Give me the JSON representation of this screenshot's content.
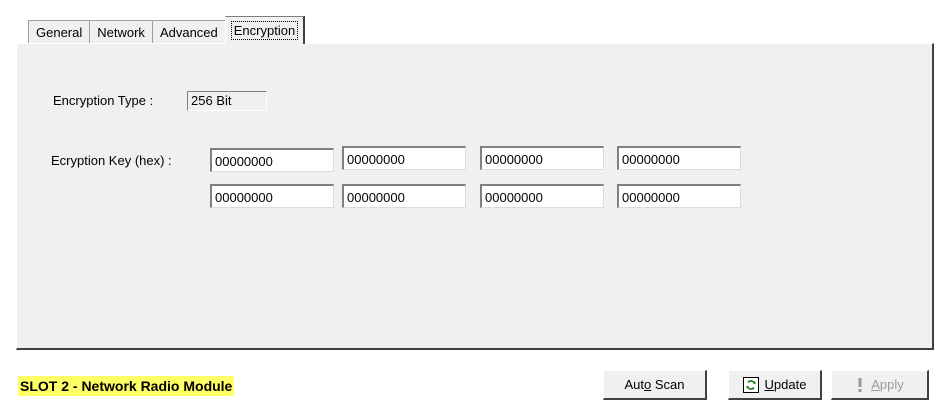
{
  "tabs": [
    {
      "label": "General"
    },
    {
      "label": "Network"
    },
    {
      "label": "Advanced"
    },
    {
      "label": "Encryption",
      "active": true
    }
  ],
  "encryption": {
    "type_label": "Encryption Type :",
    "type_value": "256 Bit",
    "key_label": "Ecryption Key (hex) :",
    "keys": [
      "00000000",
      "00000000",
      "00000000",
      "00000000",
      "00000000",
      "00000000",
      "00000000",
      "00000000"
    ]
  },
  "status": {
    "text": "SLOT 2 - Network Radio Module",
    "highlight_color": "#ffff66"
  },
  "buttons": {
    "auto_scan": {
      "pre": "Aut",
      "underline": "o",
      "post": " Scan"
    },
    "update": {
      "underline": "U",
      "post": "pdate",
      "icon": "refresh-icon"
    },
    "apply": {
      "underline": "A",
      "post": "pply",
      "icon": "exclamation-icon",
      "disabled": true
    }
  }
}
